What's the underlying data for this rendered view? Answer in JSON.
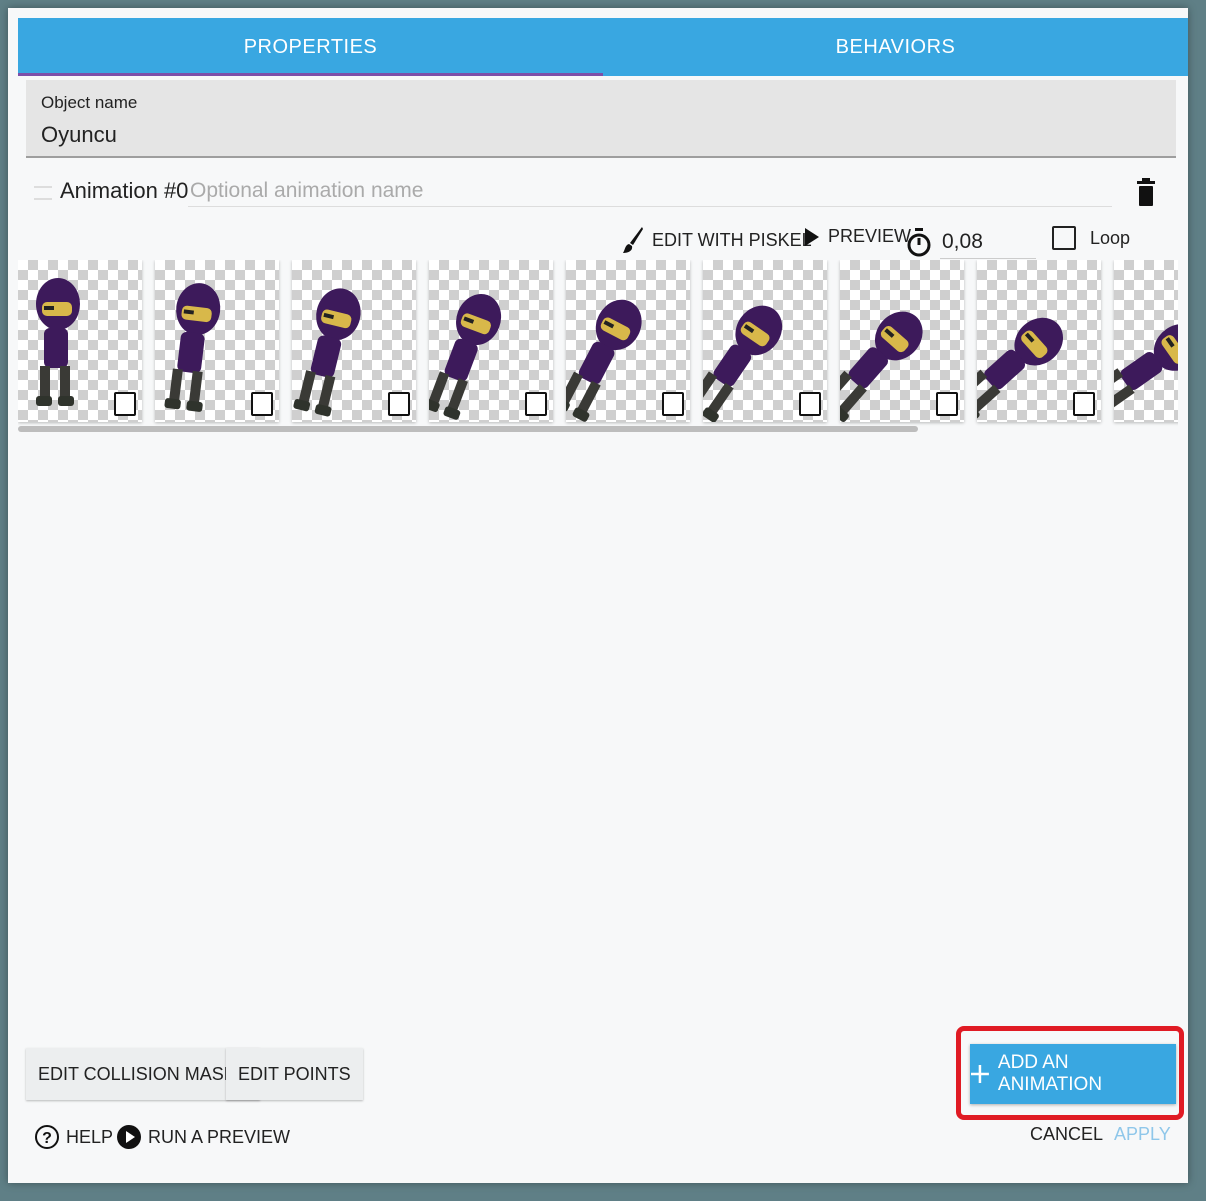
{
  "tabs": [
    {
      "label": "PROPERTIES",
      "active": true
    },
    {
      "label": "BEHAVIORS",
      "active": false
    }
  ],
  "object_name": {
    "label": "Object name",
    "value": "Oyuncu"
  },
  "animation": {
    "title": "Animation #0",
    "name_placeholder": "Optional animation name",
    "name_value": ""
  },
  "toolbar": {
    "edit_label": "EDIT WITH PISKEL",
    "preview_label": "PREVIEW",
    "interval_value": "0,08",
    "loop_label": "Loop",
    "loop_checked": false
  },
  "frames": {
    "count": 9,
    "checkbox_checked": false
  },
  "bottom": {
    "collision_label": "EDIT COLLISION MASKS",
    "points_label": "EDIT POINTS",
    "add_animation_label": "ADD AN ANIMATION"
  },
  "footer": {
    "help_label": "HELP",
    "run_preview_label": "RUN A PREVIEW",
    "cancel_label": "CANCEL",
    "apply_label": "APPLY"
  },
  "colors": {
    "accent": "#39a7e1",
    "tab_indicator": "#7d4fa8",
    "highlight": "#e01b24",
    "ninja_body": "#3d1a5b",
    "ninja_mask": "#d8b84a"
  }
}
